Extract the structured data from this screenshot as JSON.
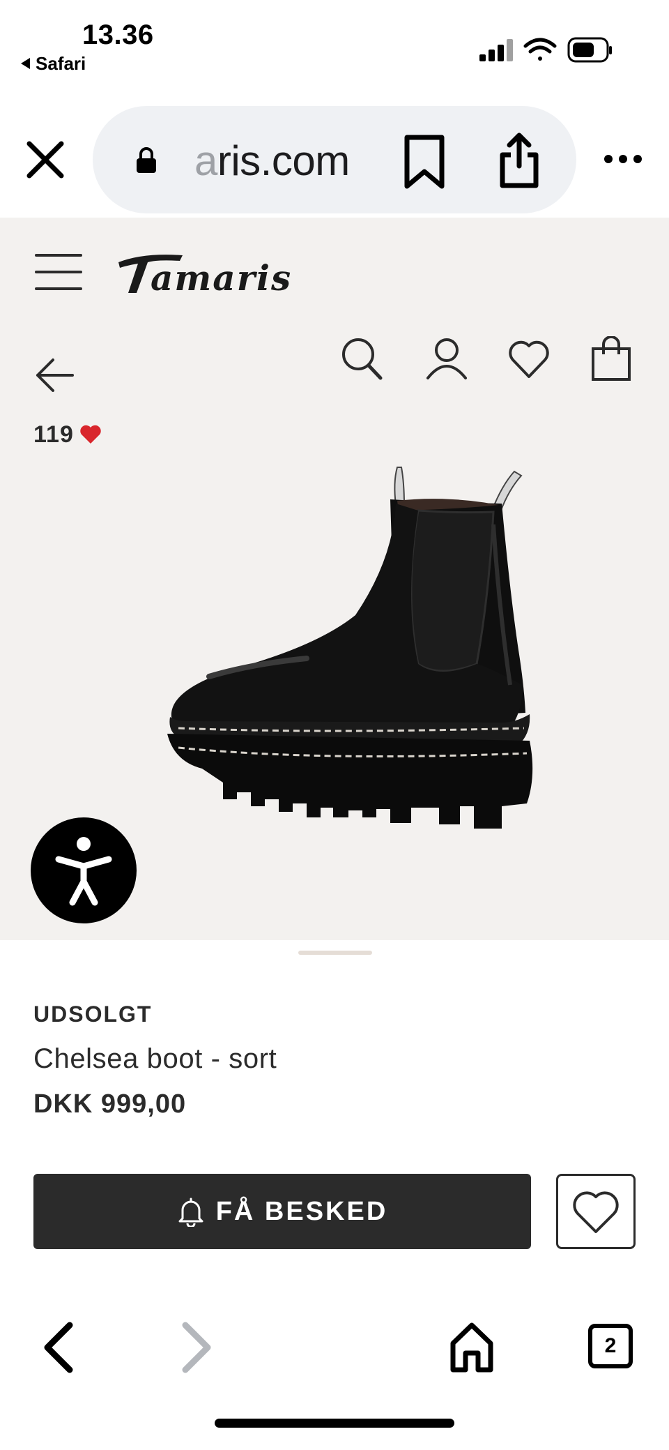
{
  "status_bar": {
    "time": "13.36",
    "back_app": "Safari",
    "icons": [
      "cellular-signal-icon",
      "wifi-icon",
      "battery-icon"
    ]
  },
  "url_bar": {
    "url_faded": "a",
    "url_text": "ris.com",
    "icons": [
      "close-icon",
      "lock-icon",
      "bookmark-icon",
      "share-icon",
      "more-icon"
    ]
  },
  "site": {
    "brand": "Tamaris",
    "header_icons": [
      "menu-icon",
      "search-icon",
      "account-icon",
      "heart-icon",
      "bag-icon"
    ],
    "likes_count": "119",
    "like_color": "#d9262c"
  },
  "product": {
    "status": "UDSOLGT",
    "name": "Chelsea boot - sort",
    "price": "DKK 999,00",
    "notify_label": "FÅ BESKED"
  },
  "toolbar": {
    "tabs_count": "2",
    "icons": [
      "chevron-left-icon",
      "chevron-right-icon",
      "home-icon",
      "tabs-icon"
    ]
  },
  "colors": {
    "page_background": "#f3f1ef",
    "primary_button": "#2b2b2b",
    "url_pill": "#eff1f4"
  }
}
